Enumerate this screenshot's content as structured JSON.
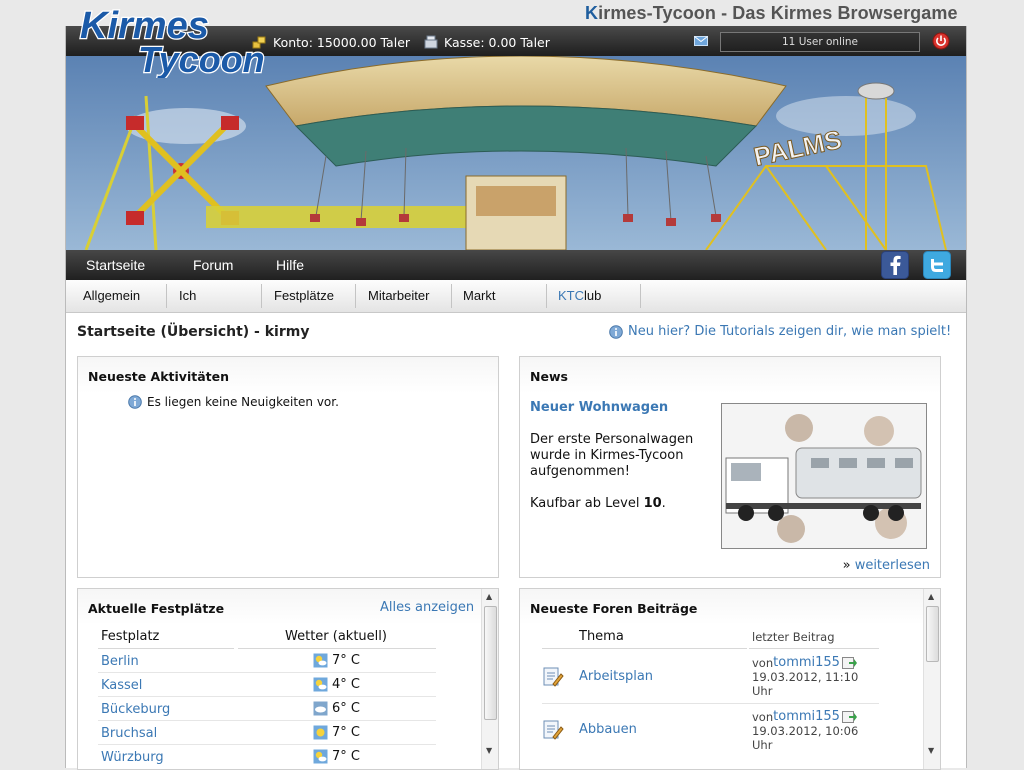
{
  "site_title_prefix": "K",
  "site_title_rest": "irmes-Tycoon - Das Kirmes Browsergame",
  "logo": {
    "line1": "Kirmes",
    "line2": "Tycoon"
  },
  "topbar": {
    "konto": "Konto: 15000.00 Taler",
    "kasse": "Kasse: 0.00 Taler",
    "users_online": "11 User online"
  },
  "nav": {
    "items": [
      "Startseite",
      "Forum",
      "Hilfe"
    ]
  },
  "subnav": {
    "tabs": [
      "Allgemein",
      "Ich",
      "Festplätze",
      "Mitarbeiter",
      "Markt"
    ],
    "club_prefix": "KTC",
    "club_rest": "lub"
  },
  "page_title": "Startseite (Übersicht) - kirmy",
  "tutorial_link": "Neu hier? Die Tutorials zeigen dir, wie man spielt!",
  "activities": {
    "title": "Neueste Aktivitäten",
    "empty": "Es liegen keine Neuigkeiten vor."
  },
  "news": {
    "title": "News",
    "headline": "Neuer Wohnwagen",
    "body_lines": [
      "Der erste Personalwagen",
      "wurde in Kirmes-Tycoon",
      "aufgenommen!"
    ],
    "level_prefix": "Kaufbar ab Level ",
    "level": "10",
    "level_suffix": ".",
    "more_marker": "»",
    "more": "weiterlesen"
  },
  "festplaetze": {
    "title": "Aktuelle Festplätze",
    "show_all": "Alles anzeigen",
    "col_place": "Festplatz",
    "col_weather": "Wetter (aktuell)",
    "rows": [
      {
        "place": "Berlin",
        "temp": "7° C"
      },
      {
        "place": "Kassel",
        "temp": "4° C"
      },
      {
        "place": "Bückeburg",
        "temp": "6° C"
      },
      {
        "place": "Bruchsal",
        "temp": "7° C"
      },
      {
        "place": "Würzburg",
        "temp": "7° C"
      }
    ]
  },
  "forum": {
    "title": "Neueste Foren Beiträge",
    "col_topic": "Thema",
    "col_last": "letzter Beitrag",
    "posts": [
      {
        "topic": "Arbeitsplan",
        "by": "von ",
        "user": "tommi155",
        "date": "19.03.2012, 11:10",
        "time_unit": "Uhr"
      },
      {
        "topic": "Abbauen",
        "by": "von ",
        "user": "tommi155",
        "date": "19.03.2012, 10:06",
        "time_unit": "Uhr"
      }
    ]
  },
  "colors": {
    "link": "#3b78b4",
    "bar": "#2a2a2a",
    "club_accent": "#3b78b4"
  }
}
